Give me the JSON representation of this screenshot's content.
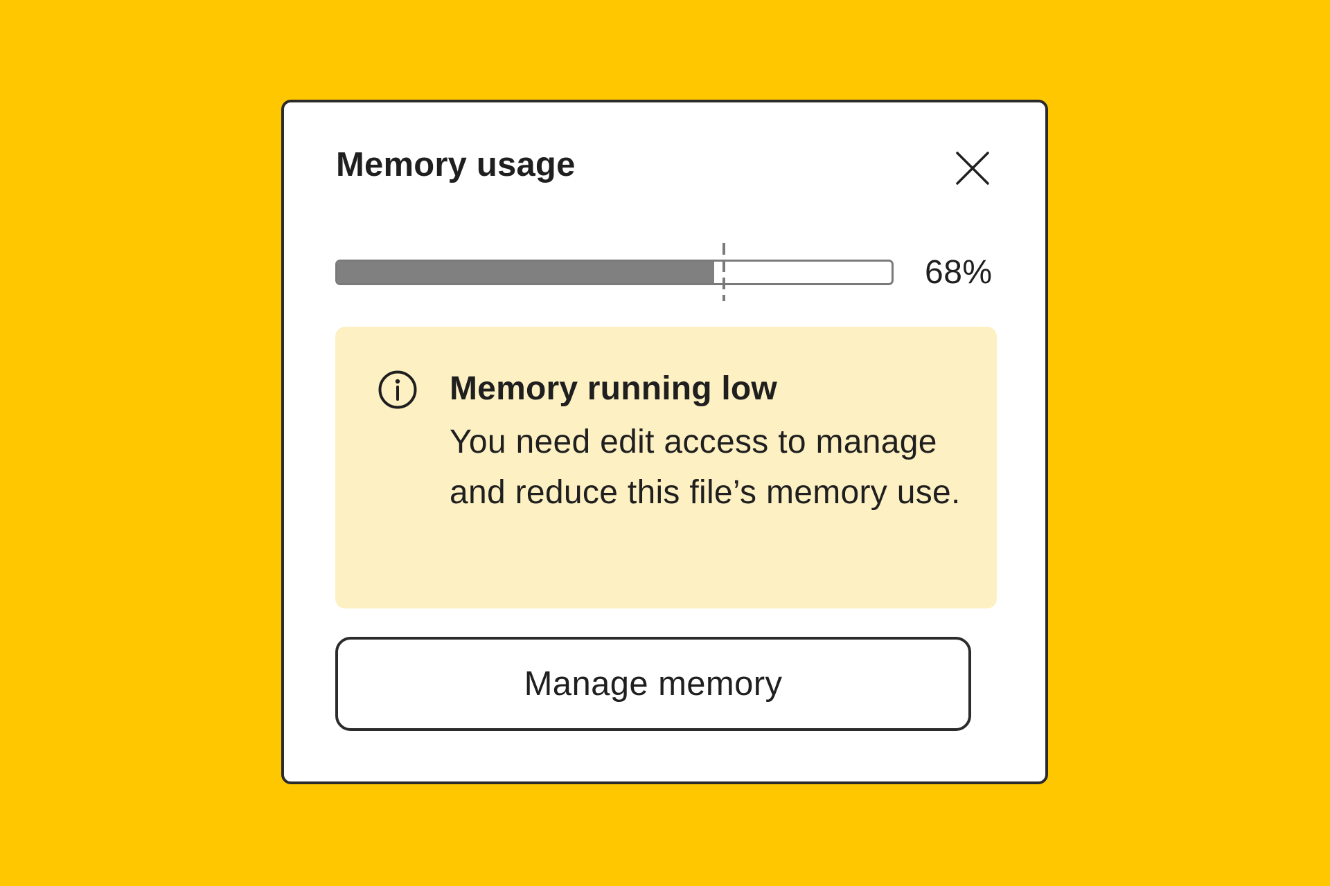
{
  "dialog": {
    "title": "Memory usage",
    "close_icon": "close-icon"
  },
  "usage": {
    "percent_label": "68%",
    "fill_fraction": 0.68,
    "fill_color": "#808080"
  },
  "alert": {
    "icon": "info-icon",
    "title": "Memory running low",
    "body": "You need edit access to manage and reduce this file’s memory use.",
    "background_color": "#FDF0C2"
  },
  "actions": {
    "manage_label": "Manage memory"
  },
  "colors": {
    "page_background": "#FFC700",
    "dialog_background": "#FFFFFF",
    "border": "#2B2B2B"
  }
}
